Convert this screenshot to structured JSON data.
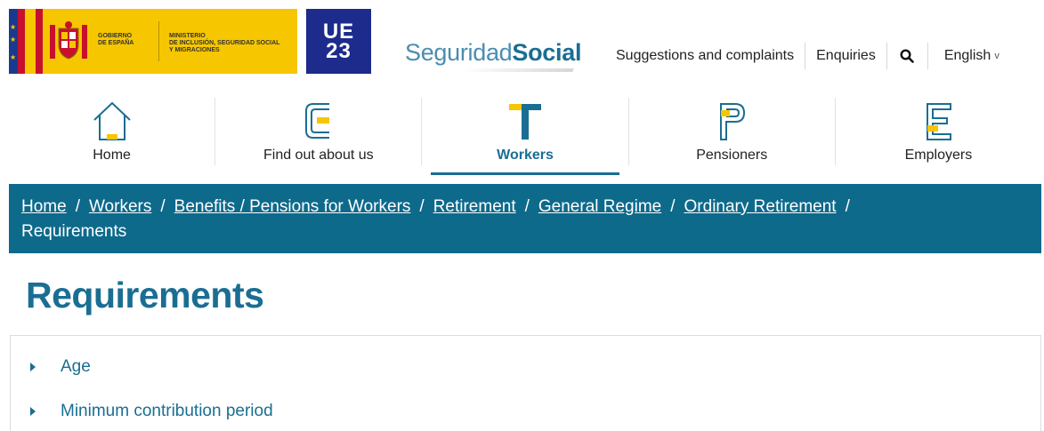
{
  "header": {
    "gov_logo_line1": "GOBIERNO",
    "gov_logo_line2": "DE ESPAÑA",
    "ministry_line1": "MINISTERIO",
    "ministry_line2": "DE INCLUSIÓN, SEGURIDAD SOCIAL",
    "ministry_line3": "Y MIGRACIONES",
    "ue_line1": "UE",
    "ue_line2": "23",
    "brand_part1": "Seguridad",
    "brand_part2": "Social",
    "links": {
      "suggestions": "Suggestions and complaints",
      "enquiries": "Enquiries",
      "language": "English"
    },
    "icons": {
      "search": "search-icon",
      "language_chevron": "chevron-down-icon"
    }
  },
  "nav": {
    "items": [
      {
        "label": "Home",
        "icon": "house-icon",
        "active": false
      },
      {
        "label": "Find out about us",
        "icon": "letter-c-icon",
        "active": false
      },
      {
        "label": "Workers",
        "icon": "letter-t-icon",
        "active": true
      },
      {
        "label": "Pensioners",
        "icon": "letter-p-icon",
        "active": false
      },
      {
        "label": "Employers",
        "icon": "letter-e-icon",
        "active": false
      }
    ]
  },
  "breadcrumb": {
    "items": [
      "Home",
      "Workers",
      "Benefits / Pensions for Workers",
      "Retirement",
      "General Regime",
      "Ordinary Retirement"
    ],
    "current": "Requirements",
    "separator": "/"
  },
  "page": {
    "title": "Requirements"
  },
  "accordion": {
    "items": [
      "Age",
      "Minimum contribution period"
    ]
  },
  "colors": {
    "brand": "#1a6e93",
    "breadcrumb_bg": "#0e6a8b",
    "accent_yellow": "#f6c600",
    "ue_blue": "#1d2b8c"
  }
}
